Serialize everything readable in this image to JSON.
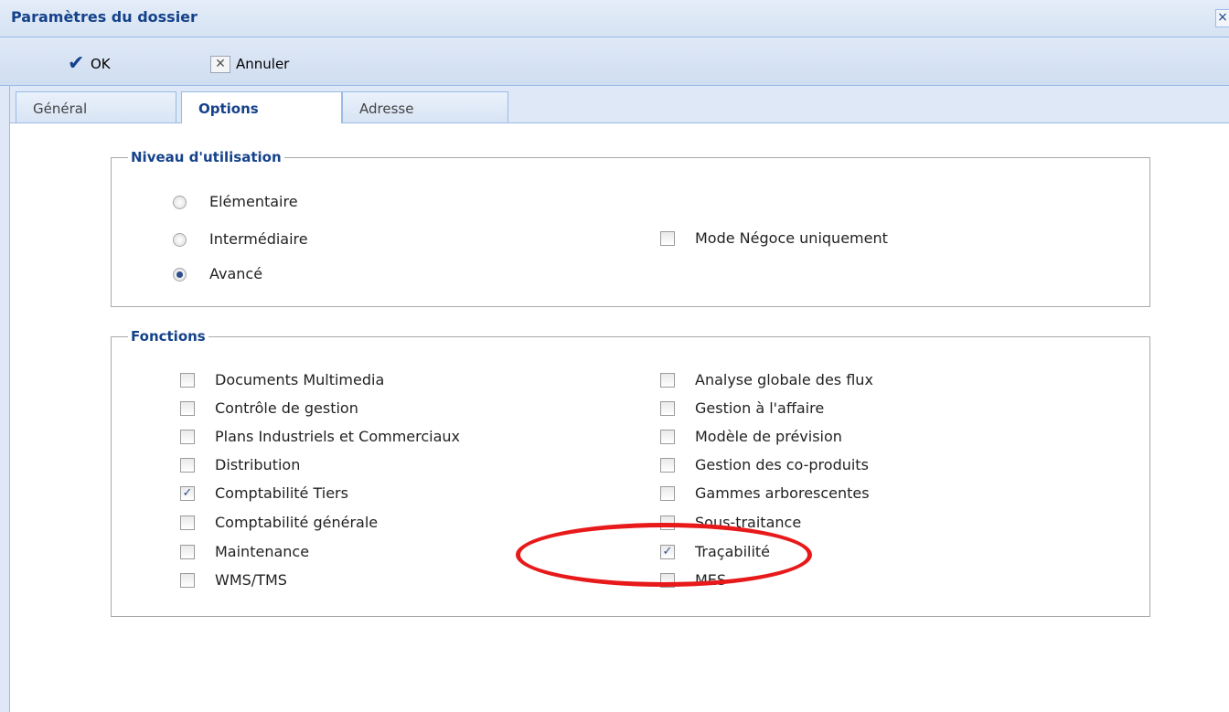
{
  "window": {
    "title": "Paramètres du dossier",
    "close_glyph": "×"
  },
  "toolbar": {
    "ok_label": "OK",
    "cancel_label": "Annuler"
  },
  "tabs": [
    {
      "label": "Général"
    },
    {
      "label": "Options",
      "active": true
    },
    {
      "label": "Adresse"
    }
  ],
  "level": {
    "legend": "Niveau d'utilisation",
    "options": [
      {
        "label": "Elémentaire",
        "selected": false
      },
      {
        "label": "Intermédiaire",
        "selected": false
      },
      {
        "label": "Avancé",
        "selected": true
      }
    ],
    "mode_negoce": {
      "label": "Mode Négoce uniquement",
      "checked": false
    }
  },
  "functions": {
    "legend": "Fonctions",
    "left": [
      {
        "label": "Documents Multimedia",
        "checked": false
      },
      {
        "label": "Contrôle de gestion",
        "checked": false
      },
      {
        "label": "Plans Industriels et Commerciaux",
        "checked": false
      },
      {
        "label": "Distribution",
        "checked": false
      },
      {
        "label": "Comptabilité Tiers",
        "checked": true
      },
      {
        "label": "Comptabilité générale",
        "checked": false
      },
      {
        "label": "Maintenance",
        "checked": false
      },
      {
        "label": "WMS/TMS",
        "checked": false
      }
    ],
    "right": [
      {
        "label": "Analyse globale des flux",
        "checked": false
      },
      {
        "label": "Gestion à l'affaire",
        "checked": false
      },
      {
        "label": "Modèle de prévision",
        "checked": false
      },
      {
        "label": "Gestion des co-produits",
        "checked": false
      },
      {
        "label": "Gammes arborescentes",
        "checked": false
      },
      {
        "label": "Sous-traitance",
        "checked": false
      },
      {
        "label": "Traçabilité",
        "checked": true
      },
      {
        "label": "MES",
        "checked": false
      }
    ]
  },
  "colors": {
    "accent": "#15428b",
    "annotation": "#e8191a",
    "chrome": "#dfe8f6"
  }
}
